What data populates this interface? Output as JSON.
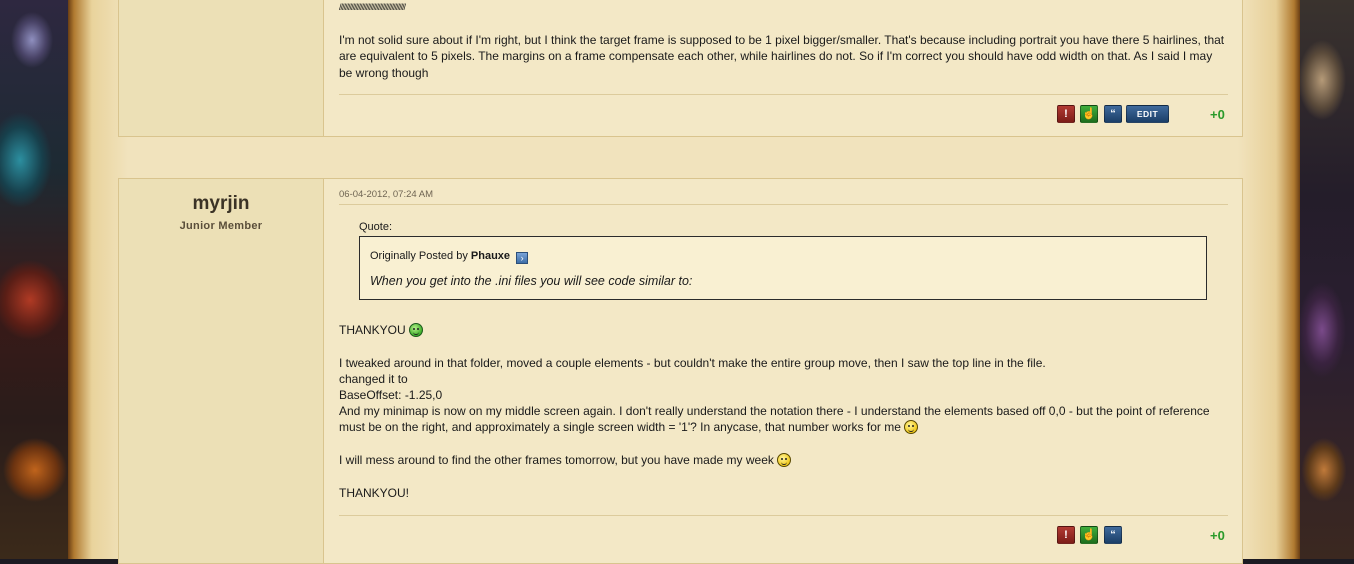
{
  "post1": {
    "slashes": "////////////////////////////////////////////",
    "body": "I'm not solid sure about if I'm right, but I think the target frame is supposed to be 1 pixel bigger/smaller. That's because including portrait you have there 5 hairlines, that are equivalent to 5 pixels. The margins on a frame compensate each other, while hairlines do not. So if I'm correct you should have odd width on that. As I said I may be wrong though",
    "actions": {
      "edit_label": "EDIT"
    },
    "reputation": "+0"
  },
  "post2": {
    "username": "myrjin",
    "user_title": "Junior Member",
    "date": "06-04-2012, 07:24 AM",
    "quote": {
      "label": "Quote:",
      "originally_posted_by": "Originally Posted by",
      "author": "Phauxe",
      "text": "When you get into the .ini files you will see code similar to:"
    },
    "lines": {
      "l1": "THANKYOU",
      "l2": "I tweaked around in that folder, moved a couple elements - but couldn't make the entire group move, then I saw the top line in the file.",
      "l3": "changed it to",
      "l4": "BaseOffset: -1.25,0",
      "l5": "And my minimap is now on my middle screen again. I don't really understand the notation there - I understand the elements based off 0,0 - but the point of reference must be on the right, and approximately a single screen width = '1'? In anycase, that number works for me",
      "l6": "I will mess around to find the other frames tomorrow, but you have made my week",
      "l7": "THANKYOU!"
    },
    "reputation": "+0"
  },
  "icons": {
    "report": "report-icon",
    "like": "thumbs-up-icon",
    "quote": "quote-icon",
    "view_post": "view-post-arrow-icon",
    "grin": "grin-smiley-icon",
    "smile": "smile-icon"
  },
  "colors": {
    "parchment": "#f3e8c6",
    "userbox": "#ece0b6",
    "reputation_green": "#2a9a2a",
    "button_blue": "#1b3f68",
    "button_red": "#7d1d18",
    "button_green": "#1d6e1d"
  }
}
